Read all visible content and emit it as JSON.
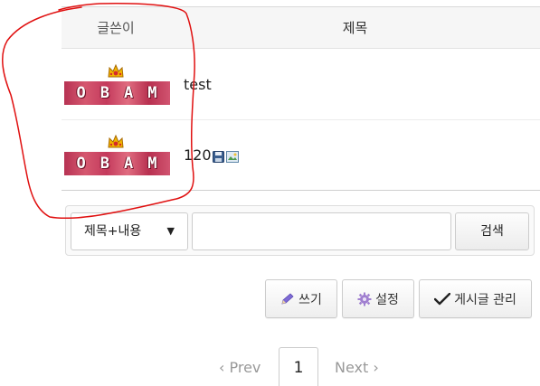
{
  "table": {
    "headers": {
      "author": "글쓴이",
      "title": "제목"
    },
    "rows": [
      {
        "author_badge": "OBAM",
        "title": "test",
        "icons": []
      },
      {
        "author_badge": "OBAM",
        "title": "120",
        "icons": [
          "save-icon",
          "image-icon"
        ]
      }
    ]
  },
  "search": {
    "scope_selected": "제목+내용",
    "caret": "▼",
    "query_value": "",
    "button_label": "검색"
  },
  "actions": {
    "write_label": "쓰기",
    "settings_label": "설정",
    "manage_label": "게시글 관리"
  },
  "pagination": {
    "prev_label": "‹ Prev",
    "current_page": "1",
    "next_label": "Next ›"
  },
  "colors": {
    "annotation_stroke": "#e01010",
    "header_bg": "#f6f6f6",
    "badge": "#c43a5c"
  }
}
